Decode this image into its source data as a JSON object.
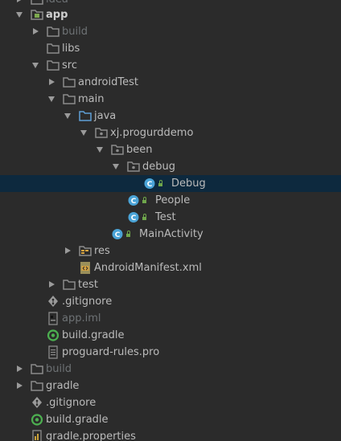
{
  "tree": {
    "rows": [
      {
        "label": "idea",
        "icon": "folder-icon",
        "dim": true
      },
      {
        "label": "app",
        "icon": "module-folder-icon",
        "bold": true
      },
      {
        "label": "build",
        "icon": "folder-icon",
        "dim": true
      },
      {
        "label": "libs",
        "icon": "folder-icon"
      },
      {
        "label": "src",
        "icon": "folder-icon"
      },
      {
        "label": "androidTest",
        "icon": "folder-icon"
      },
      {
        "label": "main",
        "icon": "folder-icon"
      },
      {
        "label": "java",
        "icon": "source-folder-icon"
      },
      {
        "label": "xj.progurddemo",
        "icon": "package-icon"
      },
      {
        "label": "been",
        "icon": "package-icon"
      },
      {
        "label": "debug",
        "icon": "package-icon"
      },
      {
        "label": "Debug",
        "icon": "class-icon",
        "selected": true
      },
      {
        "label": "People",
        "icon": "class-icon"
      },
      {
        "label": "Test",
        "icon": "class-icon"
      },
      {
        "label": "MainActivity",
        "icon": "class-icon"
      },
      {
        "label": "res",
        "icon": "resource-folder-icon"
      },
      {
        "label": "AndroidManifest.xml",
        "icon": "manifest-icon"
      },
      {
        "label": "test",
        "icon": "folder-icon"
      },
      {
        "label": ".gitignore",
        "icon": "gitignore-icon"
      },
      {
        "label": "app.iml",
        "icon": "iml-file-icon",
        "dim": true
      },
      {
        "label": "build.gradle",
        "icon": "gradle-icon"
      },
      {
        "label": "proguard-rules.pro",
        "icon": "text-file-icon"
      },
      {
        "label": "build",
        "icon": "folder-icon",
        "dim": true
      },
      {
        "label": "gradle",
        "icon": "folder-icon"
      },
      {
        "label": ".gitignore",
        "icon": "gitignore-icon"
      },
      {
        "label": "build.gradle",
        "icon": "gradle-icon"
      },
      {
        "label": "gradle.properties",
        "icon": "properties-file-icon"
      }
    ]
  },
  "colors": {
    "background": "#2b2b2b",
    "selection": "#0d293e",
    "text": "#bbbbbb",
    "dim_text": "#6e7275",
    "folder": "#8b8b8b",
    "class_badge": "#4aa3d6",
    "lock": "#6fa64b"
  }
}
